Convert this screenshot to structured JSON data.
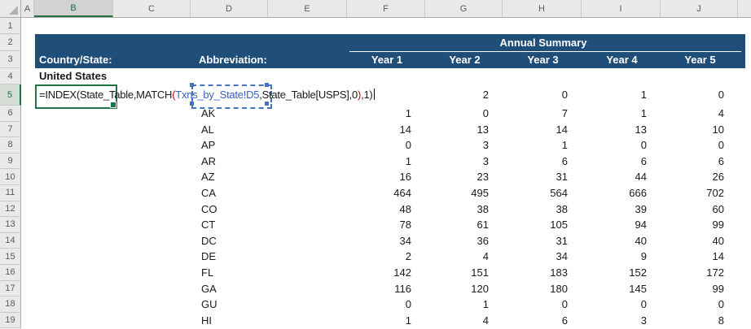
{
  "sheet": {
    "column_letters": [
      "A",
      "B",
      "C",
      "D",
      "E",
      "F",
      "G",
      "H",
      "I",
      "J"
    ],
    "row_numbers": [
      "1",
      "2",
      "3",
      "4",
      "5",
      "6",
      "7",
      "8",
      "9",
      "10",
      "11",
      "12",
      "13",
      "14",
      "15",
      "16",
      "17",
      "18",
      "19"
    ],
    "selected_column": "B",
    "selected_row": "5"
  },
  "header": {
    "annual_summary": "Annual Summary",
    "country_state": "Country/State:",
    "abbreviation": "Abbreviation:",
    "years": [
      "Year 1",
      "Year 2",
      "Year 3",
      "Year 4",
      "Year 5"
    ]
  },
  "formula": {
    "segments": [
      {
        "text": "=INDEX(State_Table,MATCH",
        "color": "default"
      },
      {
        "text": "(",
        "color": "red"
      },
      {
        "text": "Txns_by_State!D5",
        "color": "blue"
      },
      {
        "text": ",State_Table[USPS],0",
        "color": "default"
      },
      {
        "text": ")",
        "color": "red"
      },
      {
        "text": ",1)",
        "color": "default"
      }
    ],
    "cursor": "|"
  },
  "table": {
    "country": "United States",
    "active_row_values_g_to_j": [
      "2",
      "0",
      "1",
      "0"
    ],
    "rows": [
      {
        "abbr": "AK",
        "values": [
          "1",
          "0",
          "7",
          "1",
          "4"
        ]
      },
      {
        "abbr": "AL",
        "values": [
          "14",
          "13",
          "14",
          "13",
          "10"
        ]
      },
      {
        "abbr": "AP",
        "values": [
          "0",
          "3",
          "1",
          "0",
          "0"
        ]
      },
      {
        "abbr": "AR",
        "values": [
          "1",
          "3",
          "6",
          "6",
          "6"
        ]
      },
      {
        "abbr": "AZ",
        "values": [
          "16",
          "23",
          "31",
          "44",
          "26"
        ]
      },
      {
        "abbr": "CA",
        "values": [
          "464",
          "495",
          "564",
          "666",
          "702"
        ]
      },
      {
        "abbr": "CO",
        "values": [
          "48",
          "38",
          "38",
          "39",
          "60"
        ]
      },
      {
        "abbr": "CT",
        "values": [
          "78",
          "61",
          "105",
          "94",
          "99"
        ]
      },
      {
        "abbr": "DC",
        "values": [
          "34",
          "36",
          "31",
          "40",
          "40"
        ]
      },
      {
        "abbr": "DE",
        "values": [
          "2",
          "4",
          "34",
          "9",
          "14"
        ]
      },
      {
        "abbr": "FL",
        "values": [
          "142",
          "151",
          "183",
          "152",
          "172"
        ]
      },
      {
        "abbr": "GA",
        "values": [
          "116",
          "120",
          "180",
          "145",
          "99"
        ]
      },
      {
        "abbr": "GU",
        "values": [
          "0",
          "1",
          "0",
          "0",
          "0"
        ]
      },
      {
        "abbr": "HI",
        "values": [
          "1",
          "4",
          "6",
          "3",
          "8"
        ]
      }
    ]
  },
  "colors": {
    "header_background": "#1F4E79",
    "selection_green": "#217346",
    "reference_blue": "#4472C4",
    "formula_reference_text": "#3A62C4",
    "formula_paren_red": "#C00000"
  }
}
